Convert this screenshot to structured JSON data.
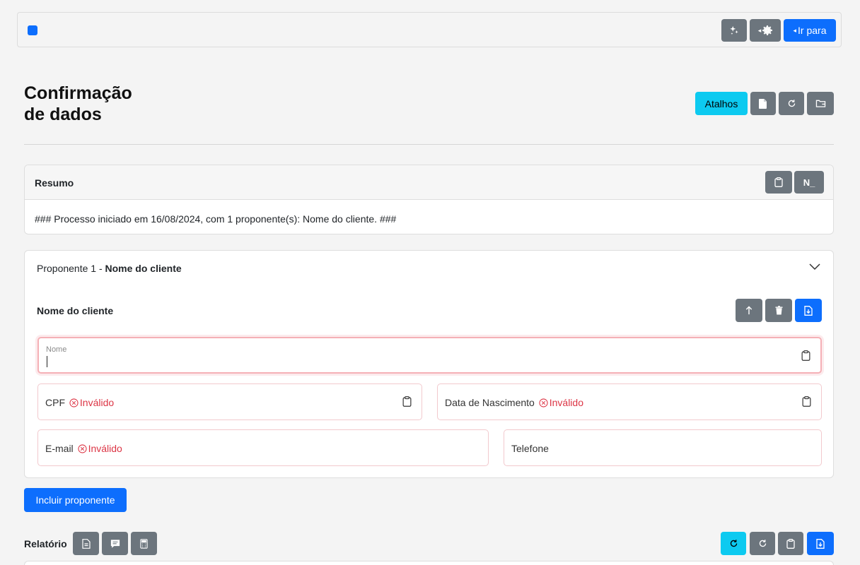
{
  "navbar": {
    "goto_label": "Ir para",
    "icons": [
      "sparkle-icon",
      "gear-icon"
    ]
  },
  "page": {
    "title": "Confirmação de dados"
  },
  "header_actions": {
    "shortcuts_label": "Atalhos",
    "icons": [
      "document-icon",
      "refresh-icon",
      "folder-icon"
    ]
  },
  "summary": {
    "title": "Resumo",
    "text": "### Processo iniciado em 16/08/2024, com 1 proponente(s): Nome do cliente. ###",
    "terminal_label": "N_"
  },
  "proponent": {
    "prefix": "Proponente 1 - ",
    "name": "Nome do cliente",
    "section_title": "Nome do cliente",
    "fields": {
      "nome": {
        "label": "Nome",
        "value": ""
      },
      "cpf": {
        "label": "CPF",
        "status": "Inválido"
      },
      "birth": {
        "label": "Data de Nascimento",
        "status": "Inválido"
      },
      "email": {
        "label": "E-mail",
        "status": "Inválido"
      },
      "phone": {
        "label": "Telefone"
      }
    }
  },
  "add_proponent_label": "Incluir proponente",
  "report": {
    "label": "Relatório"
  },
  "colors": {
    "primary": "#0d6efd",
    "secondary": "#6c757d",
    "info": "#0dcaf0",
    "danger": "#dc3545"
  }
}
